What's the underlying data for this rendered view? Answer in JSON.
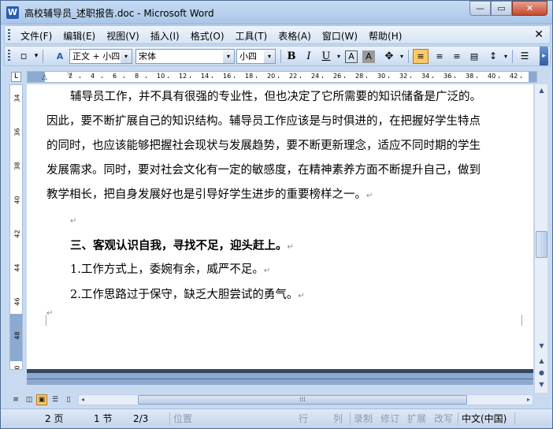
{
  "window": {
    "title": "高校辅导员_述职报告.doc - Microsoft Word",
    "app_icon": "W",
    "minimize": "—",
    "restore": "▭",
    "close": "✕"
  },
  "menu": {
    "items": [
      "文件(F)",
      "编辑(E)",
      "视图(V)",
      "插入(I)",
      "格式(O)",
      "工具(T)",
      "表格(A)",
      "窗口(W)",
      "帮助(H)"
    ],
    "close_doc": "✕"
  },
  "toolbar": {
    "style_value": "正文 + 小四",
    "font_value": "宋体",
    "size_value": "小四",
    "bold": "B",
    "italic": "I",
    "underline": "U",
    "char_border": "A",
    "char_shading": "A",
    "highlight": "A",
    "dropdown_arrow": "▾",
    "chevron": "▸"
  },
  "ruler": {
    "tab_selector": "L",
    "h_numbers": [
      "2",
      "4",
      "6",
      "8",
      "10",
      "12",
      "14",
      "16",
      "18",
      "20",
      "22",
      "24",
      "26",
      "28",
      "30",
      "32",
      "34",
      "36",
      "38",
      "40",
      "42"
    ],
    "v_numbers": [
      "34",
      "36",
      "38",
      "40",
      "42",
      "44",
      "46",
      "48",
      "50"
    ]
  },
  "document": {
    "paragraph1_lines": [
      "辅导员工作，并不具有很强的专业性，但也决定了它所需要的知识储备是广泛的。",
      "因此，要不断扩展自己的知识结构。辅导员工作应该是与时俱进的，在把握好学生特点",
      "的同时，也应该能够把握社会现状与发展趋势，要不断更新理念，适应不同时期的学生",
      "发展需求。同时，要对社会文化有一定的敏感度，在精神素养方面不断提升自己，做到",
      "教学相长，把自身发展好也是引导好学生进步的重要榜样之一。"
    ],
    "paragraph_mark": "↵",
    "heading": "三、客观认识自我，寻找不足，迎头赶上。",
    "item1": "1.工作方式上，委婉有余，威严不足。",
    "item2": "2.工作思路过于保守，缺乏大胆尝试的勇气。"
  },
  "scrollbar": {
    "up": "▲",
    "down": "▼",
    "prev_page": "▲",
    "select_browse": "●",
    "next_page": "▼",
    "h_left": "◂",
    "h_right": "▸",
    "thumb_grip": "⁞⁞⁞"
  },
  "statusbar": {
    "page": "2 页",
    "section": "1 节",
    "page_of": "2/3",
    "position": "位置",
    "line": "行",
    "column": "列",
    "rec": "录制",
    "trk": "修订",
    "ext": "扩展",
    "ovr": "改写",
    "language": "中文(中国)"
  }
}
